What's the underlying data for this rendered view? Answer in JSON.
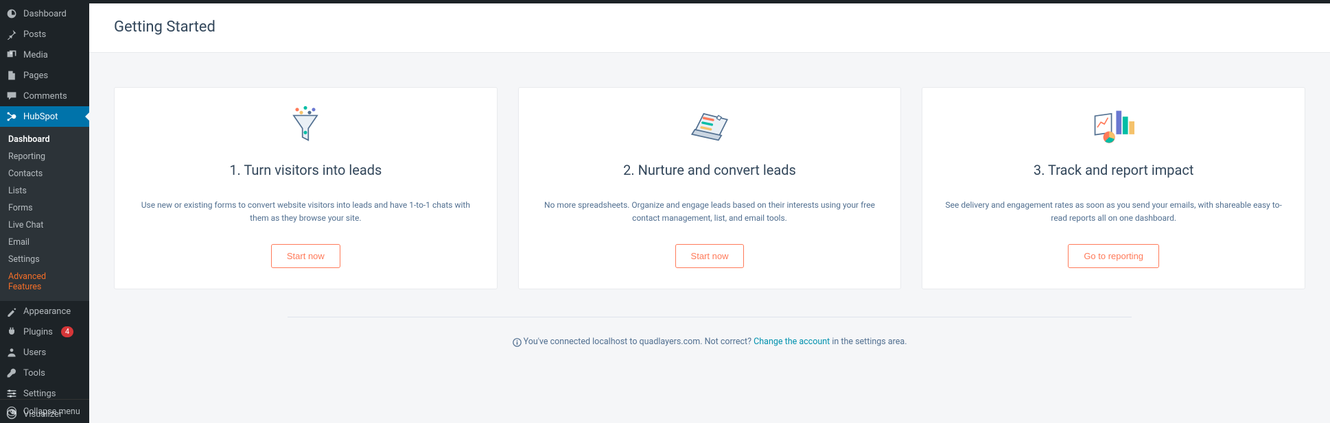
{
  "sidebar": {
    "items": [
      {
        "label": "Dashboard",
        "icon": "dashboard"
      },
      {
        "label": "Posts",
        "icon": "pin"
      },
      {
        "label": "Media",
        "icon": "media"
      },
      {
        "label": "Pages",
        "icon": "page"
      },
      {
        "label": "Comments",
        "icon": "comment"
      },
      {
        "label": "HubSpot",
        "icon": "hubspot",
        "current": true
      },
      {
        "label": "Appearance",
        "icon": "appearance"
      },
      {
        "label": "Plugins",
        "icon": "plugin",
        "badge": "4"
      },
      {
        "label": "Users",
        "icon": "users"
      },
      {
        "label": "Tools",
        "icon": "tools"
      },
      {
        "label": "Settings",
        "icon": "settings"
      },
      {
        "label": "Visualizer",
        "icon": "visualizer"
      }
    ],
    "submenu": [
      {
        "label": "Dashboard",
        "active": true
      },
      {
        "label": "Reporting"
      },
      {
        "label": "Contacts"
      },
      {
        "label": "Lists"
      },
      {
        "label": "Forms"
      },
      {
        "label": "Live Chat"
      },
      {
        "label": "Email"
      },
      {
        "label": "Settings"
      },
      {
        "label": "Advanced Features",
        "highlight": true
      }
    ],
    "collapse_label": "Collapse menu"
  },
  "header": {
    "title": "Getting Started"
  },
  "cards": [
    {
      "title": "1. Turn visitors into leads",
      "desc": "Use new or existing forms to convert website visitors into leads and have 1-to-1 chats with them as they browse your site.",
      "button": "Start now"
    },
    {
      "title": "2. Nurture and convert leads",
      "desc": "No more spreadsheets. Organize and engage leads based on their interests using your free contact management, list, and email tools.",
      "button": "Start now"
    },
    {
      "title": "3. Track and report impact",
      "desc": "See delivery and engagement rates as soon as you send your emails, with shareable easy to-read reports all on one dashboard.",
      "button": "Go to reporting"
    }
  ],
  "footer": {
    "text_before": "You've connected localhost to quadlayers.com. Not correct? ",
    "link_text": "Change the account",
    "text_after": " in the settings area."
  }
}
